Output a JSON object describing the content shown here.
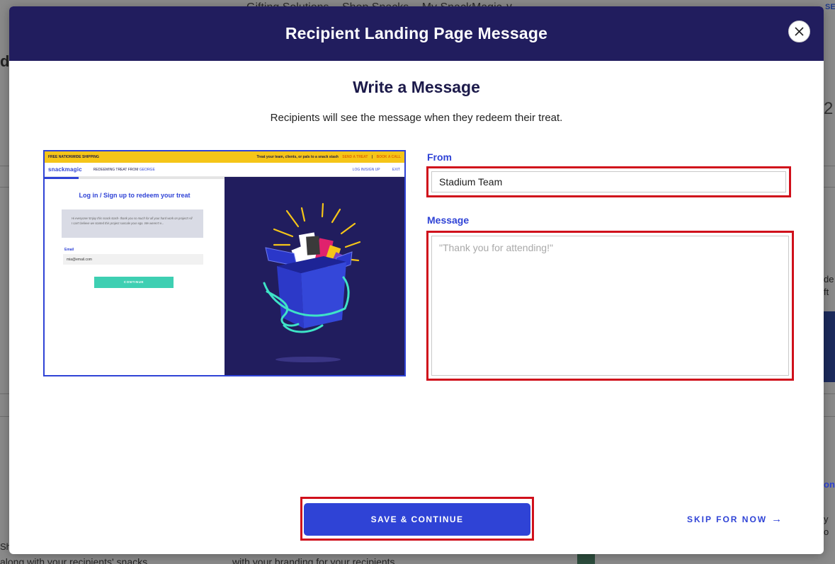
{
  "background": {
    "nav": [
      "Gifting Solutions",
      "Shop Snacks",
      "My SnackMagic ∨"
    ],
    "fragments": {
      "right_se": "SE",
      "left_d": "d",
      "right_2": "2",
      "right_de": "de",
      "right_ft": "ft",
      "right_on": "on",
      "right_y": "y",
      "right_o": "o",
      "left_sh": "Sh",
      "bottom_left": "along with your recipients' snacks",
      "bottom_mid": "with your branding for your recipients"
    }
  },
  "modal": {
    "title": "Recipient Landing Page Message",
    "close_label": "✕",
    "section_title": "Write a Message",
    "section_subtitle": "Recipients will see the message when they redeem their treat."
  },
  "preview": {
    "topbar_left": "FREE NATIONWIDE SHIPPING",
    "topbar_text": "Treat your team, clients, or pals to a snack stash",
    "topbar_send": "SEND A TREAT",
    "topbar_sep": "|",
    "topbar_book": "BOOK A CALL",
    "logo": "snackmagic",
    "redeeming_text": "REDEEMING TREAT FROM",
    "redeeming_name": "GEORGE",
    "nav_login": "LOG IN/SIGN UP",
    "nav_exit": "EXIT",
    "heading": "Log in / Sign up to redeem your treat",
    "message_text": "Hi everyone! Enjoy this snack stash- thank you so much for all your hard work on project! All I can't believe we started this project suncale your ego. We weren't e...",
    "email_label": "Email",
    "email_value": "mia@email.com",
    "continue_label": "CONTINUE"
  },
  "form": {
    "from_label": "From",
    "from_value": "Stadium Team",
    "message_label": "Message",
    "message_placeholder": "\"Thank you for attending!\"",
    "message_value": ""
  },
  "actions": {
    "save_label": "SAVE & CONTINUE",
    "skip_label": "SKIP FOR NOW",
    "skip_arrow": "→"
  },
  "colors": {
    "header_bg": "#211d5e",
    "accent": "#2f43d6",
    "highlight": "#d0101b",
    "preview_topbar": "#f5c518",
    "preview_continue": "#3ecfb2"
  }
}
